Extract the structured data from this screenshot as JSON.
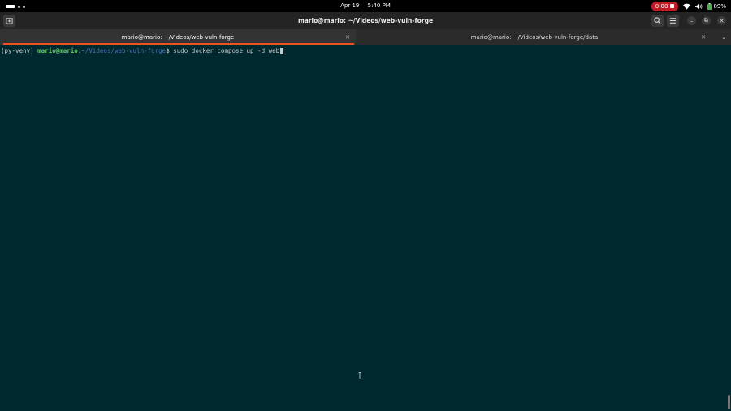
{
  "topbar": {
    "date": "Apr 19",
    "time": "5:40 PM",
    "recording": "0:00",
    "battery": "89%",
    "icons": [
      "workspace-indicator",
      "wifi-icon",
      "volume-icon",
      "battery-icon",
      "stop-icon"
    ]
  },
  "window": {
    "title": "mario@mario: ~/Videos/web-vuln-forge"
  },
  "tabs": [
    {
      "label": "mario@mario: ~/Videos/web-vuln-forge",
      "active": true
    },
    {
      "label": "mario@mario: ~/Videos/web-vuln-forge/data",
      "active": false
    }
  ],
  "terminal": {
    "venv": "(py-venv) ",
    "userhost": "mario@mario",
    "colon": ":",
    "path": "~/Videos/web-vuln-forge",
    "prompt_symbol": "$ ",
    "command": "sudo docker compose up -d web"
  },
  "colors": {
    "terminal_bg": "#00292f",
    "userhost": "#63c963",
    "path": "#4a74b0",
    "tab_accent": "#e95420",
    "record": "#c01c28"
  }
}
